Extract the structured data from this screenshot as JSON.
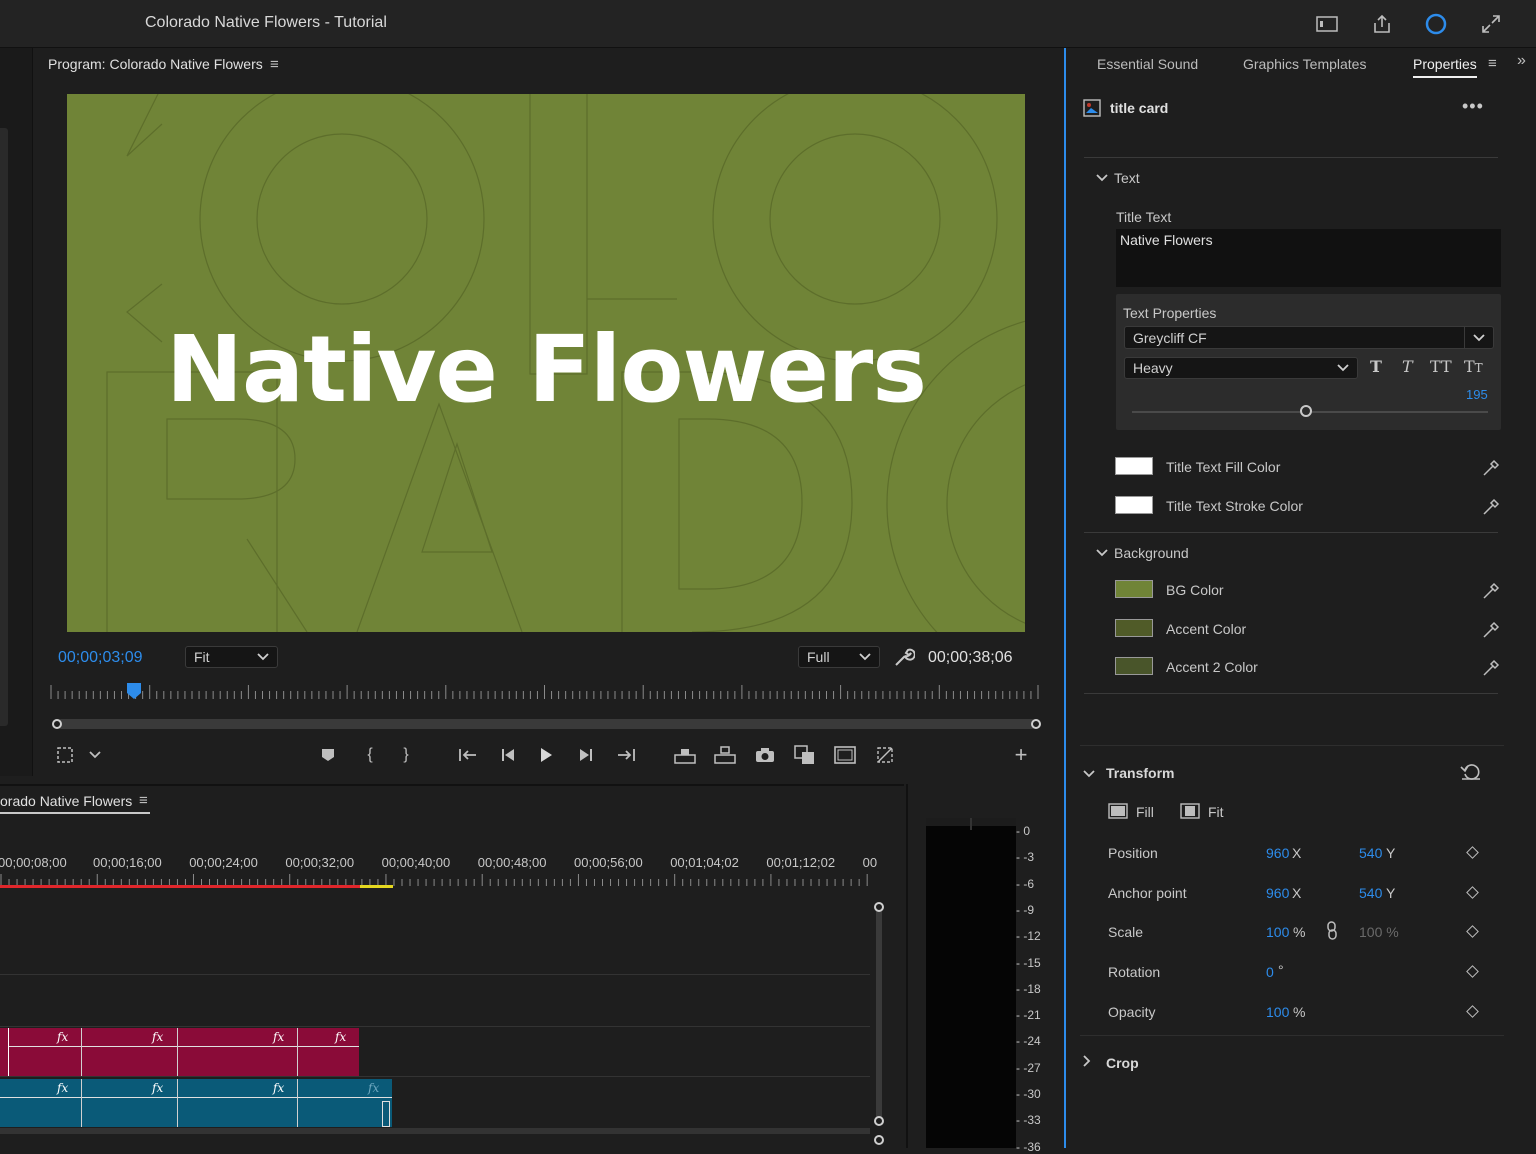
{
  "app": {
    "title": "Colorado Native Flowers - Tutorial"
  },
  "program": {
    "title": "Program: Colorado Native Flowers",
    "frame_text": "Native Flowers",
    "timecode_current": "00;00;03;09",
    "timecode_duration": "00;00;38;06",
    "zoom": "Fit",
    "resolution": "Full",
    "playhead_fraction": 0.085
  },
  "timeline": {
    "sequence_name": "orado Native Flowers",
    "ruler_labels": [
      "00;00;08;00",
      "00;00;16;00",
      "00;00;24;00",
      "00;00;32;00",
      "00;00;40;00",
      "00;00;48;00",
      "00;00;56;00",
      "00;01;04;02",
      "00;01;12;02",
      "00"
    ],
    "fx_label": "fx"
  },
  "meter": {
    "labels": [
      "0",
      "-3",
      "-6",
      "-9",
      "-12",
      "-15",
      "-18",
      "-21",
      "-24",
      "-27",
      "-30",
      "-33",
      "-36"
    ]
  },
  "props_panel": {
    "tabs": [
      "Essential Sound",
      "Graphics Templates",
      "Properties"
    ],
    "active_tab": "Properties",
    "layer_name": "title card",
    "text_section": "Text",
    "title_text_label": "Title Text",
    "title_text_value": "Native Flowers",
    "text_properties_label": "Text Properties",
    "font": "Greycliff CF",
    "weight": "Heavy",
    "size_value": "195",
    "fill_color_label": "Title Text Fill Color",
    "stroke_color_label": "Title Text Stroke Color",
    "background_section": "Background",
    "bg_color_label": "BG Color",
    "accent_color_label": "Accent Color",
    "accent2_color_label": "Accent 2 Color",
    "transform_section": "Transform",
    "fill_label": "Fill",
    "fit_label": "Fit",
    "position_label": "Position",
    "position_x": "960",
    "position_y": "540",
    "anchor_label": "Anchor point",
    "anchor_x": "960",
    "anchor_y": "540",
    "scale_label": "Scale",
    "scale_value": "100",
    "scale_value2": "100 %",
    "rotation_label": "Rotation",
    "rotation_value": "0",
    "opacity_label": "Opacity",
    "opacity_value": "100",
    "crop_section": "Crop",
    "x_unit": "X",
    "y_unit": "Y",
    "pct_unit": "%",
    "deg_unit": "°"
  },
  "colors": {
    "accent_blue": "#2d8ceb",
    "bg_color": "#708437",
    "accent_color": "#505b28",
    "accent2_color": "#49552a",
    "video_clip": "#8a0b38",
    "audio_clip": "#0a5a78",
    "fill_color": "#ffffff",
    "stroke_color": "#ffffff"
  },
  "icons": [
    "panel-menu-icon",
    "wrench-icon",
    "marker-icon",
    "play-icon",
    "camera-icon",
    "eyedropper-icon",
    "reset-icon",
    "link-icon",
    "keyframe-icon",
    "chevron-down-icon",
    "chevron-right-icon",
    "more-icon",
    "bold-icon",
    "italic-icon",
    "caps-icon",
    "smallcaps-icon",
    "overflow-icon"
  ]
}
